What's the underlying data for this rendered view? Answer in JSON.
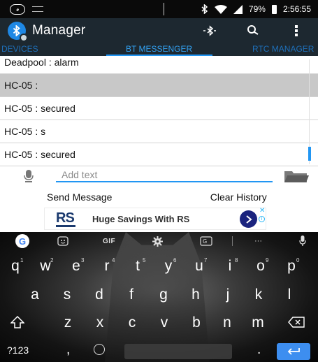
{
  "status_bar": {
    "battery": "79%",
    "time": "2:56:55",
    "icons": [
      "cat-icon",
      "notification-icon",
      "bluetooth-icon",
      "wifi-icon",
      "signal-icon",
      "battery-icon"
    ]
  },
  "app_bar": {
    "title": "Manager",
    "icons": [
      "bluetooth-logo-icon",
      "bluetooth-search-icon",
      "search-icon",
      "overflow-menu-icon"
    ]
  },
  "tabs": [
    {
      "label": "DEVICES",
      "selected": false
    },
    {
      "label": "BT MESSENGER",
      "selected": true
    },
    {
      "label": "RTC MANAGER",
      "selected": false
    }
  ],
  "messages": [
    {
      "text": "Deadpool : alarm",
      "selected": false
    },
    {
      "text": "HC-05 :",
      "selected": true
    },
    {
      "text": "HC-05 : secured",
      "selected": false
    },
    {
      "text": "HC-05 : s",
      "selected": false
    },
    {
      "text": "HC-05 : secured",
      "selected": false
    }
  ],
  "input": {
    "placeholder": "Add text",
    "value": ""
  },
  "actions": {
    "send": "Send Message",
    "clear": "Clear History"
  },
  "ad": {
    "logo": "RS",
    "text": "Huge Savings With RS"
  },
  "keyboard": {
    "toolbar": {
      "google": "G",
      "gif": "GIF",
      "more": "···"
    },
    "row1": [
      {
        "k": "q",
        "n": "1"
      },
      {
        "k": "w",
        "n": "2"
      },
      {
        "k": "e",
        "n": "3"
      },
      {
        "k": "r",
        "n": "4"
      },
      {
        "k": "t",
        "n": "5"
      },
      {
        "k": "y",
        "n": "6"
      },
      {
        "k": "u",
        "n": "7"
      },
      {
        "k": "i",
        "n": "8"
      },
      {
        "k": "o",
        "n": "9"
      },
      {
        "k": "p",
        "n": "0"
      }
    ],
    "row2": [
      "a",
      "s",
      "d",
      "f",
      "g",
      "h",
      "j",
      "k",
      "l"
    ],
    "row3": [
      "z",
      "x",
      "c",
      "v",
      "b",
      "n",
      "m"
    ],
    "symbols": "?123",
    "comma": ",",
    "period": "."
  },
  "colors": {
    "accent": "#2196f3",
    "appbar": "#1d2830",
    "statusbar": "#0a0a0a",
    "selected_row": "#c8c8c8",
    "enter_key": "#3d8ef0"
  }
}
